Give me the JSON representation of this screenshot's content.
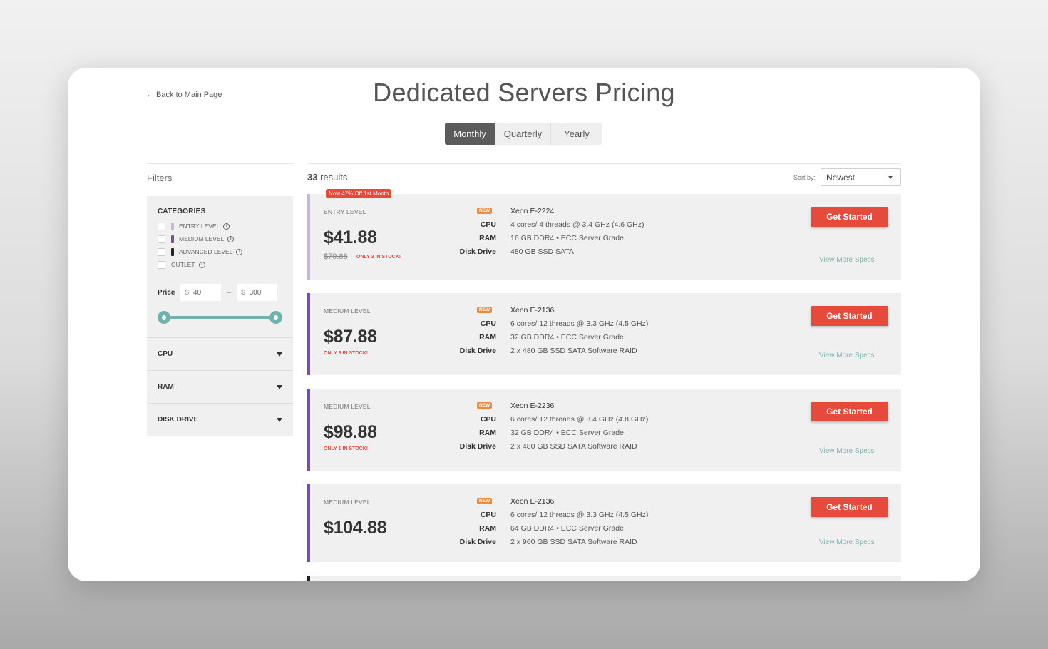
{
  "header": {
    "back_link": "← Back to Main Page",
    "title": "Dedicated Servers Pricing"
  },
  "billing_period": {
    "options": [
      "Monthly",
      "Quarterly",
      "Yearly"
    ],
    "selected": "Monthly"
  },
  "filters": {
    "label": "Filters",
    "categories_heading": "CATEGORIES",
    "categories": [
      {
        "label": "ENTRY LEVEL",
        "color": "#c8b6de"
      },
      {
        "label": "MEDIUM LEVEL",
        "color": "#7a4ba8"
      },
      {
        "label": "ADVANCED LEVEL",
        "color": "#222222"
      },
      {
        "label": "OUTLET",
        "color": null
      }
    ],
    "price": {
      "label": "Price",
      "currency": "$",
      "min": "40",
      "max": "300",
      "dash": "–"
    },
    "accordions": [
      "CPU",
      "RAM",
      "DISK DRIVE"
    ]
  },
  "results": {
    "count": "33",
    "count_suffix": " results",
    "sort_label": "Sort by:",
    "sort_value": "Newest"
  },
  "spec_keys": [
    "CPU",
    "RAM",
    "Disk Drive"
  ],
  "servers": [
    {
      "promo": "Now 47% Off 1st Month",
      "level": "ENTRY LEVEL",
      "price": "$41.88",
      "old_price": "$79.88",
      "stock": "ONLY 3 IN STOCK!",
      "badge": "NEW",
      "model": "Xeon E-2224",
      "cpu": "4 cores/ 4 threads @ 3.4 GHz (4.6 GHz)",
      "ram": "16 GB DDR4 • ECC Server Grade",
      "disk": "480 GB SSD SATA",
      "button": "Get Started",
      "link": "View More Specs"
    },
    {
      "level": "MEDIUM LEVEL",
      "price": "$87.88",
      "stock": "ONLY 3 IN STOCK!",
      "badge": "NEW",
      "model": "Xeon E-2136",
      "cpu": "6 cores/ 12 threads @ 3.3 GHz (4.5 GHz)",
      "ram": "32 GB DDR4 • ECC Server Grade",
      "disk": "2 x 480 GB SSD SATA Software RAID",
      "button": "Get Started",
      "link": "View More Specs"
    },
    {
      "level": "MEDIUM LEVEL",
      "price": "$98.88",
      "stock": "ONLY 1 IN STOCK!",
      "badge": "NEW",
      "model": "Xeon E-2236",
      "cpu": "6 cores/ 12 threads @ 3.4 GHz (4.8 GHz)",
      "ram": "32 GB DDR4 • ECC Server Grade",
      "disk": "2 x 480 GB SSD SATA Software RAID",
      "button": "Get Started",
      "link": "View More Specs"
    },
    {
      "level": "MEDIUM LEVEL",
      "price": "$104.88",
      "badge": "NEW",
      "model": "Xeon E-2136",
      "cpu": "6 cores/ 12 threads @ 3.3 GHz (4.5 GHz)",
      "ram": "64 GB DDR4 • ECC Server Grade",
      "disk": "2 x 960 GB SSD SATA Software RAID",
      "button": "Get Started",
      "link": "View More Specs"
    }
  ],
  "colors": {
    "accent_red": "#e64a3b",
    "teal": "#6fb3b0",
    "badge_orange": "#f08a3c",
    "entry_level": "#c8b6de",
    "medium_level": "#7a4ba8"
  }
}
